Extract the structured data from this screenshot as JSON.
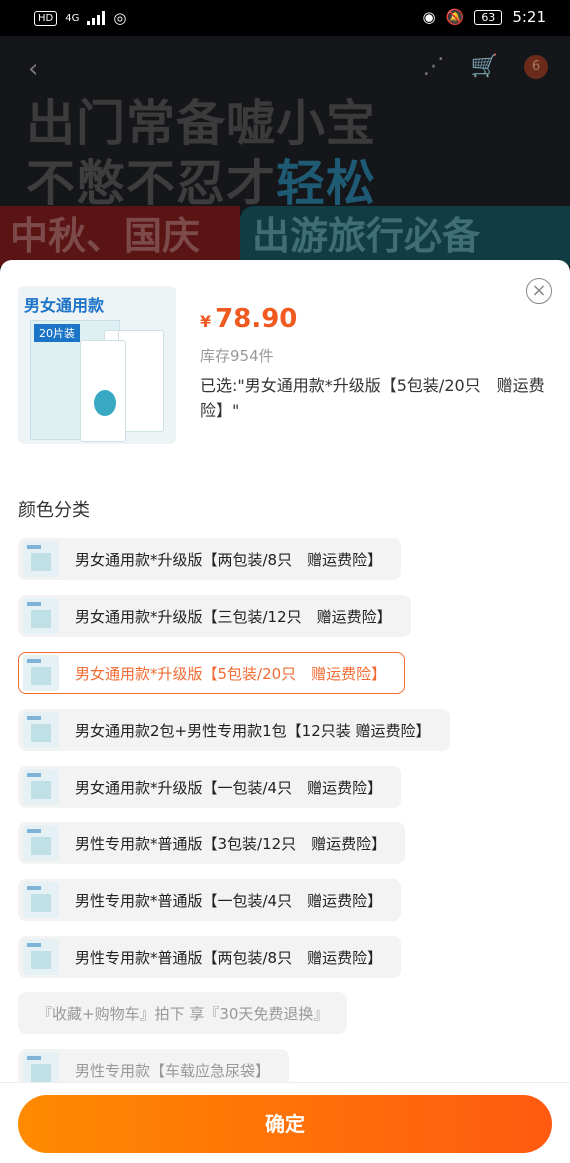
{
  "status": {
    "time": "5:21",
    "battery": "63",
    "net_badge": "HD",
    "net_type": "4G"
  },
  "banner": {
    "line1": "出门常备嘘小宝",
    "line2_prefix": "不憋不忍才",
    "line2_highlight": "轻松",
    "strip_left": "中秋、国庆",
    "strip_right": "出游旅行必备",
    "cart_badge": "6"
  },
  "product": {
    "thumb_title": "男女通用款",
    "thumb_tag": "20片装",
    "price_symbol": "¥",
    "price": "78.90",
    "stock": "库存954件",
    "chosen": "已选:\"男女通用款*升级版【5包装/20只　赠运费险】\""
  },
  "section_title": "颜色分类",
  "options": [
    {
      "label": "男女通用款*升级版【两包装/8只　赠运费险】"
    },
    {
      "label": "男女通用款*升级版【三包装/12只　赠运费险】"
    },
    {
      "label": "男女通用款*升级版【5包装/20只　赠运费险】"
    },
    {
      "label": "男女通用款2包+男性专用款1包【12只装 赠运费险】"
    },
    {
      "label": "男女通用款*升级版【一包装/4只　赠运费险】"
    },
    {
      "label": "男性专用款*普通版【3包装/12只　赠运费险】"
    },
    {
      "label": "男性专用款*普通版【一包装/4只　赠运费险】"
    },
    {
      "label": "男性专用款*普通版【两包装/8只　赠运费险】"
    },
    {
      "label": "『收藏+购物车』拍下 享『30天免费退换』"
    },
    {
      "label": "男性专用款【车载应急尿袋】"
    }
  ],
  "confirm_label": "确定",
  "colors": {
    "accent": "#f26b32",
    "price": "#f05a20"
  }
}
